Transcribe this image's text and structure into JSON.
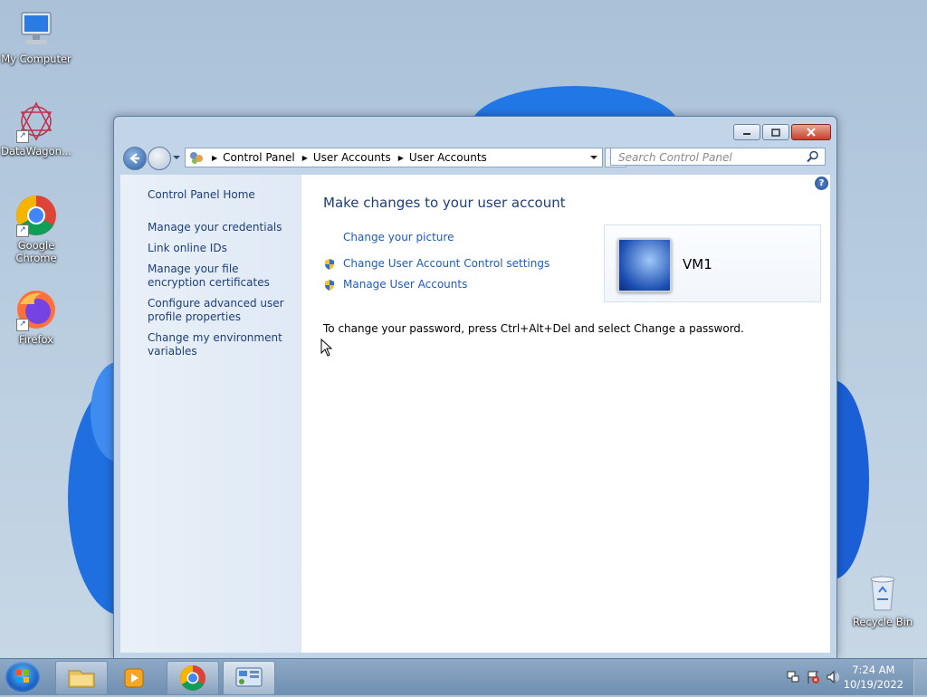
{
  "desktop": {
    "icons": [
      {
        "label": "My Computer"
      },
      {
        "label": "DataWagon..."
      },
      {
        "label": "Google Chrome"
      },
      {
        "label": "Firefox"
      },
      {
        "label": "Recycle Bin"
      }
    ]
  },
  "window": {
    "breadcrumb": [
      "Control Panel",
      "User Accounts",
      "User Accounts"
    ],
    "search_placeholder": "Search Control Panel",
    "sidebar": {
      "home": "Control Panel Home",
      "links": [
        "Manage your credentials",
        "Link online IDs",
        "Manage your file encryption certificates",
        "Configure advanced user profile properties",
        "Change my environment variables"
      ]
    },
    "main": {
      "heading": "Make changes to your user account",
      "tasks": [
        {
          "label": "Change your picture",
          "shield": false
        },
        {
          "label": "Change User Account Control settings",
          "shield": true
        },
        {
          "label": "Manage User Accounts",
          "shield": true
        }
      ],
      "password_note": "To change your password, press Ctrl+Alt+Del and select Change a password.",
      "user_name": "VM1",
      "help_symbol": "?"
    }
  },
  "taskbar": {
    "time": "7:24 AM",
    "date": "10/19/2022"
  }
}
